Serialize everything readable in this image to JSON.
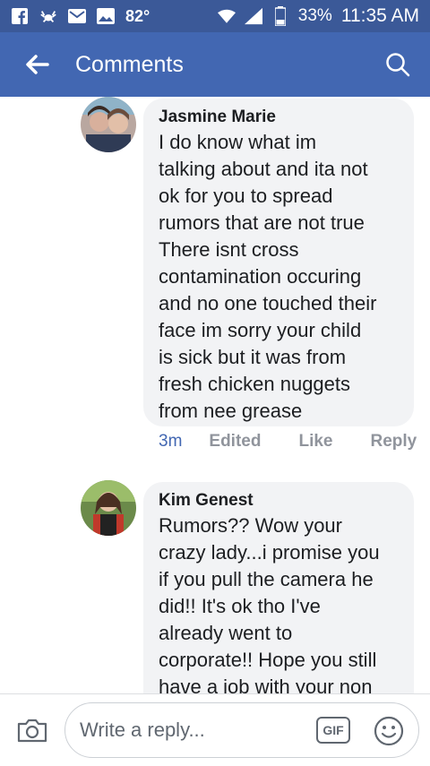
{
  "status_bar": {
    "temperature": "82°",
    "battery": "33%",
    "time": "11:35 AM"
  },
  "header": {
    "title": "Comments"
  },
  "comments": [
    {
      "author": "Jasmine Marie",
      "text": "I do know what im\ntalking about and ita not\nok for you to spread\nrumors that are not true\nThere isnt cross\ncontamination occuring\nand no one touched their\nface im sorry your child\nis sick but it was from\nfresh chicken nuggets\nfrom nee grease",
      "time": "3m",
      "edited_label": "Edited",
      "like_label": "Like",
      "reply_label": "Reply"
    },
    {
      "author": "Kim Genest",
      "text": "Rumors?? Wow your\ncrazy lady...i promise you\nif you pull the camera he\ndid!! It's ok tho I've\nalready went to\ncorporate!! Hope you still\nhave a job with your non"
    }
  ],
  "composer": {
    "placeholder": "Write a reply...",
    "gif_label": "GIF"
  },
  "colors": {
    "status_bar": "#3b5998",
    "app_bar": "#4267b2",
    "bubble": "#f2f3f5",
    "link": "#4267b2",
    "meta": "#90949c"
  }
}
